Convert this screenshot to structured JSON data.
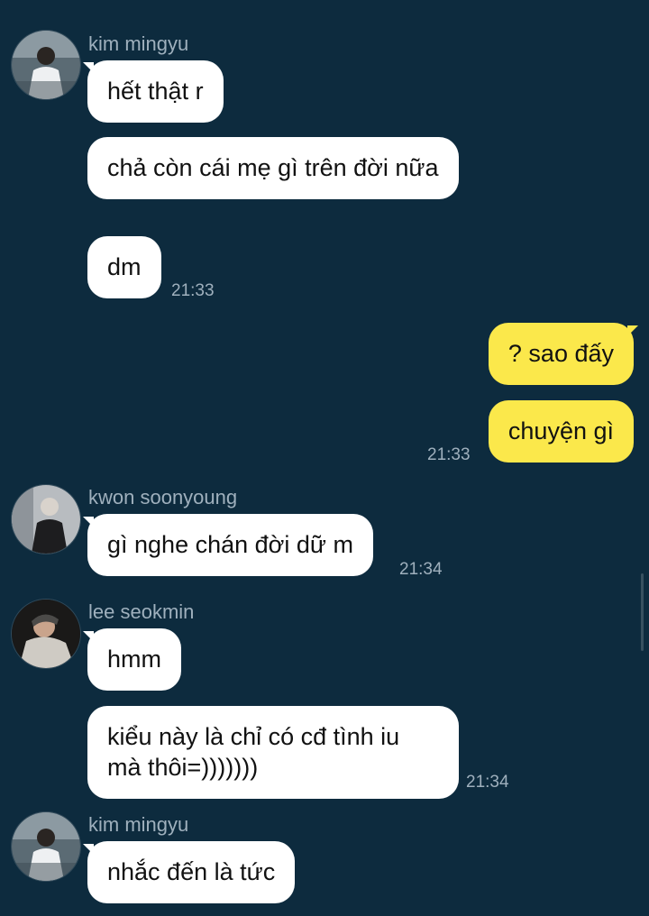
{
  "messages": [
    {
      "sender": "kim mingyu",
      "texts": [
        "hết thật r",
        "chả còn cái mẹ gì trên đời nữa",
        "dm"
      ],
      "time": "21:33"
    },
    {
      "sender": "me",
      "texts": [
        "? sao đấy",
        "chuyện gì"
      ],
      "time": "21:33"
    },
    {
      "sender": "kwon soonyoung",
      "texts": [
        "gì nghe chán đời dữ m"
      ],
      "time": "21:34"
    },
    {
      "sender": "lee seokmin",
      "texts": [
        "hmm",
        "kiểu này là chỉ có cđ tình iu mà thôi=)))))))"
      ],
      "time": "21:34"
    },
    {
      "sender": "kim mingyu",
      "texts": [
        "nhắc đến là tức"
      ],
      "time": ""
    }
  ],
  "colors": {
    "background": "#0d2b3e",
    "incoming_bubble": "#ffffff",
    "outgoing_bubble": "#fbe84b",
    "meta_text": "#9fb0bd"
  }
}
